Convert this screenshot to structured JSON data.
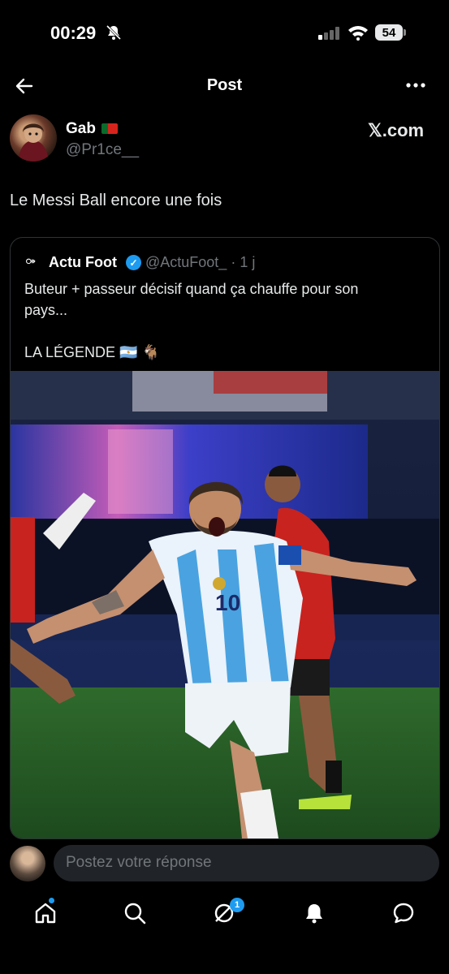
{
  "status": {
    "time": "00:29",
    "battery": "54"
  },
  "header": {
    "title": "Post"
  },
  "tweet": {
    "author_name": "Gab",
    "handle": "@Pr1ce__",
    "source": "𝕏.com",
    "text": "Le Messi Ball encore une fois"
  },
  "quote": {
    "author_name": "Actu Foot",
    "handle": "@ActuFoot_ · 1 j",
    "line1": "Buteur + passeur décisif quand ça chauffe pour son",
    "line2": "pays...",
    "line3": "LA LÉGENDE 🇦🇷 🐐",
    "image_jersey_number": "10"
  },
  "reply": {
    "placeholder": "Postez votre réponse"
  },
  "nav": {
    "messages_badge": "1"
  },
  "colors": {
    "accent": "#1d9bf0",
    "background": "#000000",
    "muted": "#71767b"
  }
}
